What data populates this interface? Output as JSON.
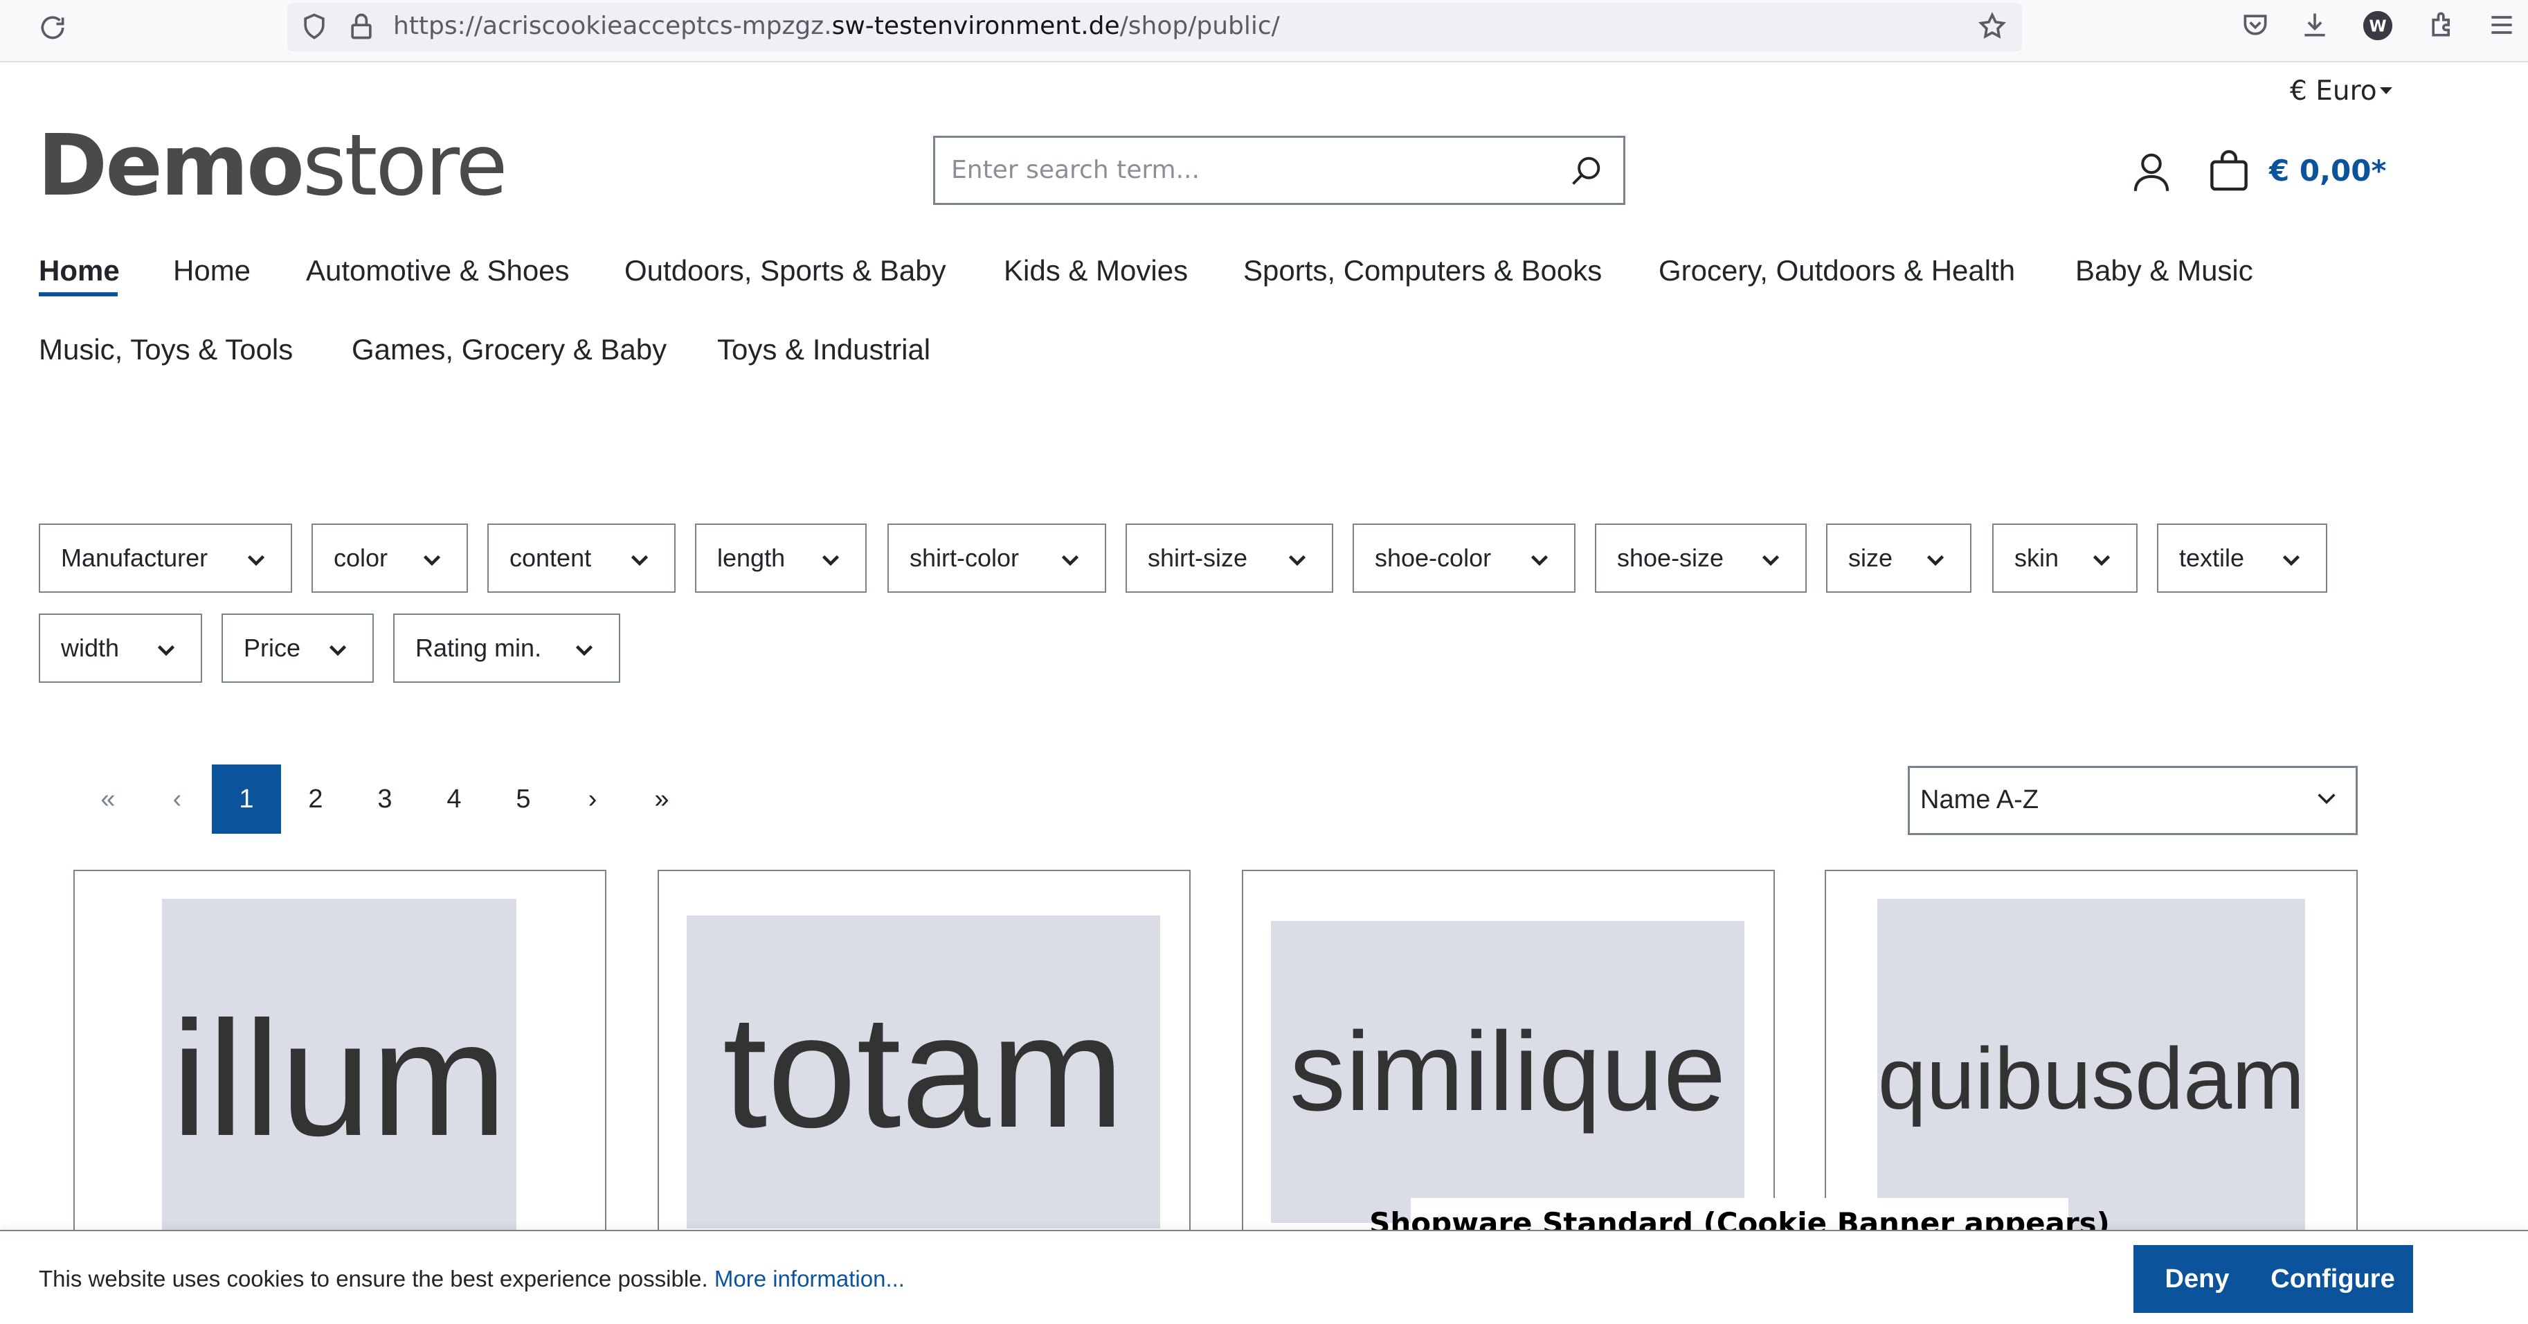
{
  "browser": {
    "url_prefix": "https://acriscookieacceptcs-mpzgz.",
    "url_domain": "sw-testenvironment.de",
    "url_path": "/shop/public/",
    "icons": [
      "reload-icon",
      "shield-icon",
      "lock-icon",
      "star-icon",
      "pocket-icon",
      "download-icon",
      "profile-icon",
      "extensions-icon",
      "menu-icon"
    ]
  },
  "header": {
    "currency": "€ Euro",
    "logo_bold": "Demo",
    "logo_light": "store",
    "search_placeholder": "Enter search term...",
    "cart_total": "€ 0,00*"
  },
  "nav": {
    "items": [
      {
        "label": "Home",
        "active": true
      },
      {
        "label": "Home"
      },
      {
        "label": "Automotive & Shoes"
      },
      {
        "label": "Outdoors, Sports & Baby"
      },
      {
        "label": "Kids & Movies"
      },
      {
        "label": "Sports, Computers & Books"
      },
      {
        "label": "Grocery, Outdoors & Health"
      },
      {
        "label": "Baby & Music"
      },
      {
        "label": "Music, Toys & Tools"
      },
      {
        "label": "Games, Grocery & Baby"
      },
      {
        "label": "Toys & Industrial"
      }
    ]
  },
  "filters": [
    "Manufacturer",
    "color",
    "content",
    "length",
    "shirt-color",
    "shirt-size",
    "shoe-color",
    "shoe-size",
    "size",
    "skin",
    "textile",
    "width",
    "Price",
    "Rating min."
  ],
  "pagination": {
    "first": "«",
    "prev": "‹",
    "pages": [
      "1",
      "2",
      "3",
      "4",
      "5"
    ],
    "current": "1",
    "next": "›",
    "last": "»"
  },
  "sort": {
    "selected": "Name A-Z"
  },
  "products": [
    {
      "image_text": "illum"
    },
    {
      "image_text": "totam"
    },
    {
      "image_text": "similique"
    },
    {
      "image_text": "quibusdam"
    }
  ],
  "cookie_banner": {
    "text": "This website uses cookies to ensure the best experience possible.",
    "link": "More information...",
    "deny": "Deny",
    "configure": "Configure"
  },
  "overlay_caption": "Shopware Standard (Cookie Banner appears)",
  "colors": {
    "primary": "#0b539b",
    "border": "#798490",
    "image_placeholder": "#dadde5"
  }
}
